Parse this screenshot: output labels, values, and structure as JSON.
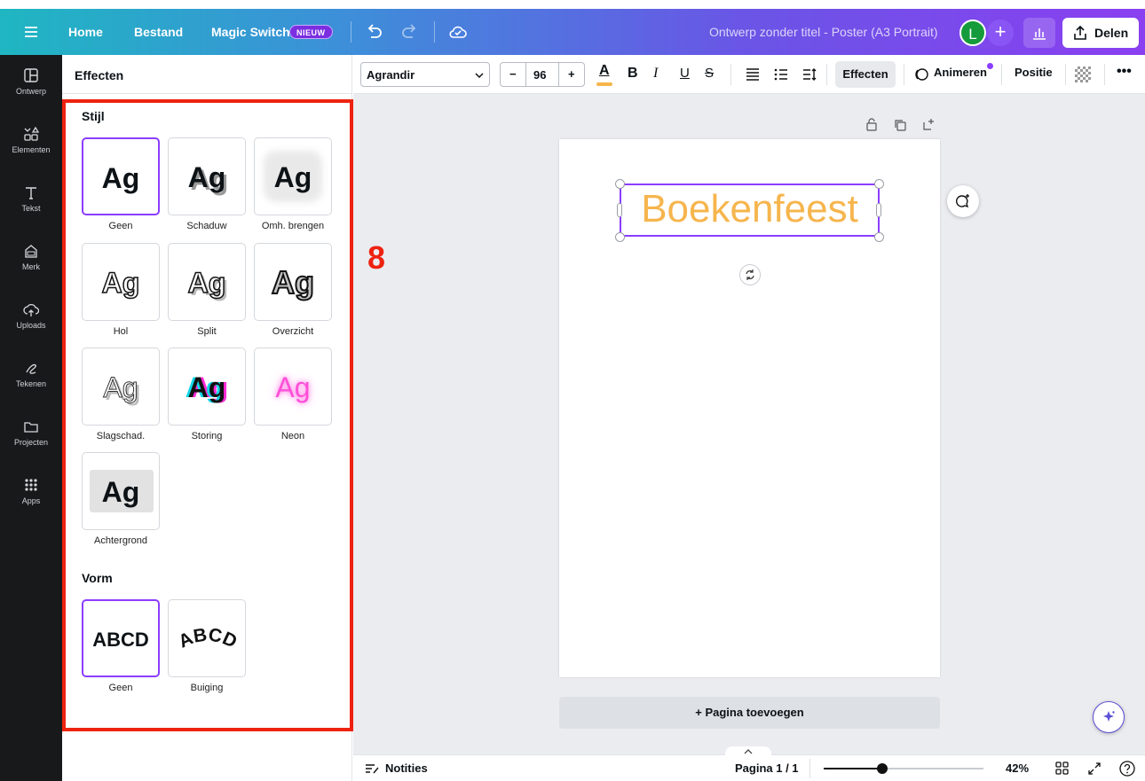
{
  "topbar": {
    "home": "Home",
    "bestand": "Bestand",
    "magic_switch": "Magic Switch",
    "new_badge": "NIEUW",
    "doc_title": "Ontwerp zonder titel - Poster (A3 Portrait)",
    "avatar_initial": "L",
    "share": "Delen"
  },
  "rail": [
    {
      "label": "Ontwerp",
      "icon": "layout-icon"
    },
    {
      "label": "Elementen",
      "icon": "shapes-icon"
    },
    {
      "label": "Tekst",
      "icon": "text-icon"
    },
    {
      "label": "Merk",
      "icon": "brand-icon"
    },
    {
      "label": "Uploads",
      "icon": "cloud-upload-icon"
    },
    {
      "label": "Tekenen",
      "icon": "draw-icon"
    },
    {
      "label": "Projecten",
      "icon": "folder-icon"
    },
    {
      "label": "Apps",
      "icon": "apps-grid-icon"
    }
  ],
  "panel": {
    "title": "Effecten",
    "style_heading": "Stijl",
    "shape_heading": "Vorm",
    "sample": "Ag",
    "shape_sample": "ABCD",
    "styles": [
      "Geen",
      "Schaduw",
      "Omh. brengen",
      "Hol",
      "Split",
      "Overzicht",
      "Slagschad.",
      "Storing",
      "Neon",
      "Achtergrond"
    ],
    "shapes": [
      "Geen",
      "Buiging"
    ]
  },
  "annotation": "8",
  "toolbar": {
    "font": "Agrandir",
    "size": "96",
    "effects": "Effecten",
    "animate": "Animeren",
    "position": "Positie"
  },
  "canvas": {
    "headline": "Boekenfeest",
    "add_page": "+ Pagina toevoegen"
  },
  "bottombar": {
    "notes": "Notities",
    "page": "Pagina 1 / 1",
    "zoom": "42%",
    "zoom_level": 0.42
  },
  "colors": {
    "accent": "#8b3dff",
    "annotation_red": "#ee2210",
    "headline": "#f6b54d"
  }
}
